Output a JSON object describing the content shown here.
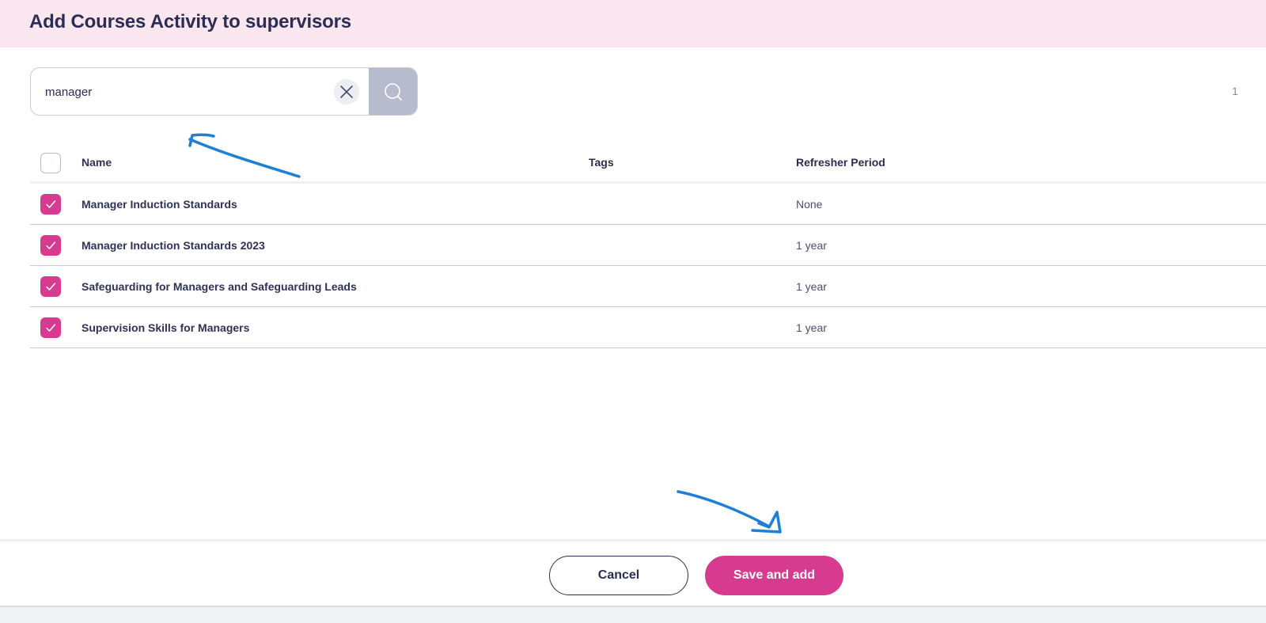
{
  "header": {
    "title": "Add Courses Activity to supervisors"
  },
  "search": {
    "value": "manager",
    "page_indicator": "1"
  },
  "table": {
    "columns": {
      "name": "Name",
      "tags": "Tags",
      "refresher_period": "Refresher Period"
    },
    "select_all_checked": false,
    "rows": [
      {
        "name": "Manager Induction Standards",
        "tags": "",
        "refresher_period": "None",
        "checked": true
      },
      {
        "name": "Manager Induction Standards 2023",
        "tags": "",
        "refresher_period": "1 year",
        "checked": true
      },
      {
        "name": "Safeguarding for Managers and Safeguarding Leads",
        "tags": "",
        "refresher_period": "1 year",
        "checked": true
      },
      {
        "name": "Supervision Skills for Managers",
        "tags": "",
        "refresher_period": "1 year",
        "checked": true
      }
    ]
  },
  "footer": {
    "cancel_label": "Cancel",
    "save_label": "Save and add"
  },
  "colors": {
    "accent": "#d63b8f",
    "header_bg": "#f9e6ef",
    "text_dark": "#2b2d52",
    "search_button": "#b6bccd",
    "annotation": "#1f7fd6"
  },
  "icons": {
    "clear": "close-icon",
    "search": "search-icon",
    "check": "check-icon"
  }
}
